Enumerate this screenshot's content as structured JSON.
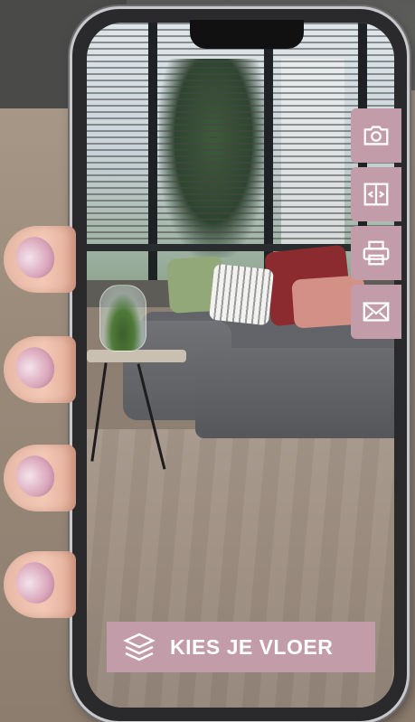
{
  "toolbar": {
    "items": [
      {
        "icon": "camera-icon"
      },
      {
        "icon": "compare-icon"
      },
      {
        "icon": "print-icon"
      },
      {
        "icon": "mail-icon"
      }
    ],
    "button_color": "#c29ca8"
  },
  "cta": {
    "label": "KIES JE VLOER",
    "icon": "layers-icon",
    "color": "#c29ca8"
  }
}
